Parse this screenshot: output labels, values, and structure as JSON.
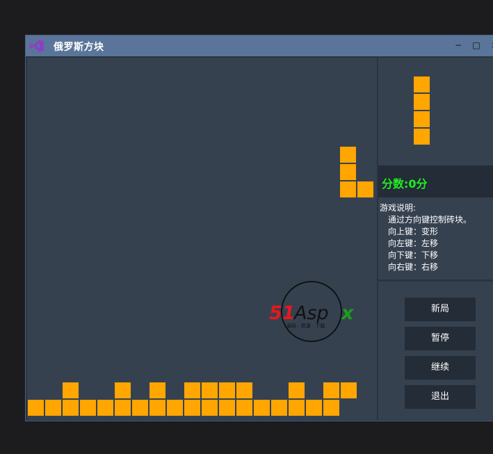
{
  "window": {
    "title": "俄罗斯方块"
  },
  "window_controls": {
    "minimize": "−",
    "maximize": "□",
    "close": "×"
  },
  "score": {
    "text": "分数:0分"
  },
  "help": {
    "title": "游戏说明:",
    "lines": [
      "通过方向键控制砖块。",
      "向上键：变形",
      "向左键：左移",
      "向下键：下移",
      "向右键：右移"
    ]
  },
  "buttons": {
    "new_game": "新局",
    "pause": "暂停",
    "resume": "继续",
    "exit": "退出"
  },
  "logo": {
    "text": "51Aspx"
  },
  "colors": {
    "block": "#ffa600",
    "score": "#22ee22",
    "titlebar": "#5a7599"
  },
  "game": {
    "bottom_row_filled": [
      1,
      1,
      1,
      1,
      1,
      1,
      1,
      1,
      1,
      1,
      1,
      1,
      1,
      1,
      1,
      1,
      1,
      1
    ],
    "second_row_filled": [
      0,
      0,
      1,
      0,
      0,
      1,
      0,
      1,
      0,
      1,
      1,
      1,
      1,
      0,
      0,
      1,
      0,
      1,
      1
    ],
    "falling_piece": {
      "type": "L",
      "cells": [
        [
          0,
          0
        ],
        [
          0,
          1
        ],
        [
          0,
          2
        ],
        [
          1,
          2
        ]
      ],
      "column": 18,
      "row": 5
    },
    "next_piece": {
      "type": "I"
    }
  }
}
